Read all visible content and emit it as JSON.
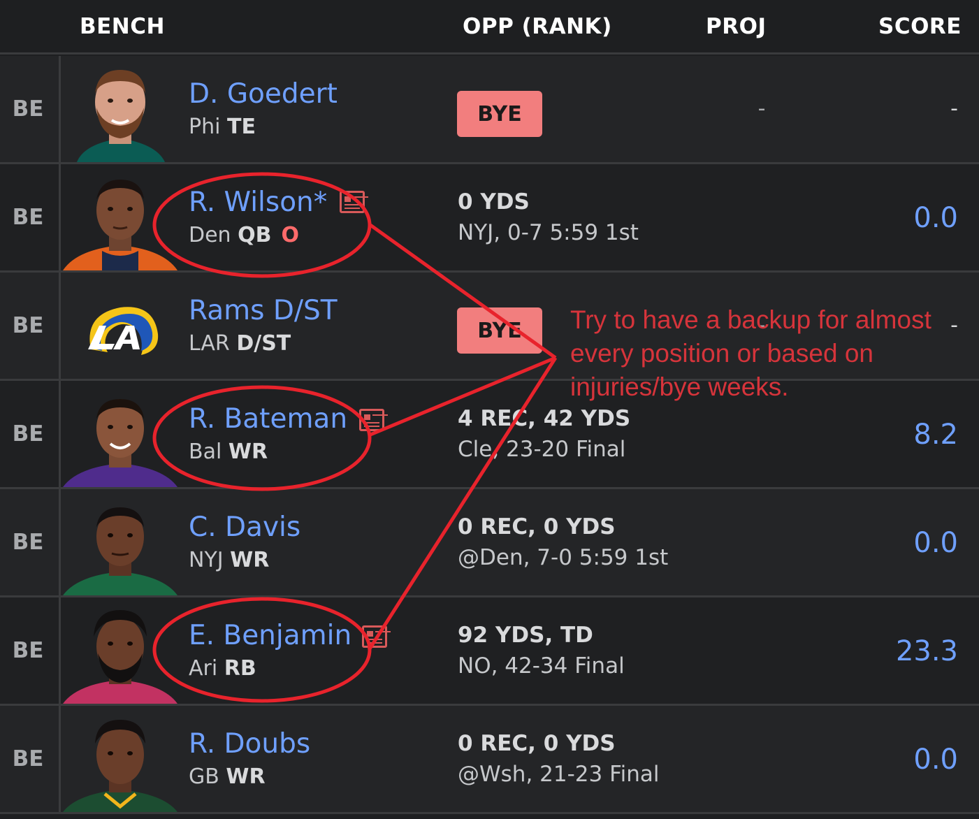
{
  "header": {
    "bench": "BENCH",
    "opp": "OPP (RANK)",
    "proj": "PROJ",
    "score": "SCORE"
  },
  "rows": [
    {
      "slot": "BE",
      "name": "D. Goedert",
      "team": "Phi",
      "pos": "TE",
      "bye": "BYE",
      "proj": "-",
      "score": "-",
      "jersey": "#0b5c54"
    },
    {
      "slot": "BE",
      "name": "R. Wilson*",
      "team": "Den",
      "pos": "QB",
      "status": "O",
      "opp_line1": "0 YDS",
      "opp_line2": "NYJ, 0-7 5:59 1st",
      "score": "0.0",
      "jersey": "#e2601d"
    },
    {
      "slot": "BE",
      "name": "Rams D/ST",
      "team": "LAR",
      "pos": "D/ST",
      "bye": "BYE",
      "proj": "-",
      "score": "-",
      "logo": "rams-logo"
    },
    {
      "slot": "BE",
      "name": "R. Bateman",
      "team": "Bal",
      "pos": "WR",
      "opp_line1": "4 REC, 42 YDS",
      "opp_line2": "Cle, 23-20 Final",
      "score": "8.2",
      "jersey": "#4f2c8c"
    },
    {
      "slot": "BE",
      "name": "C. Davis",
      "team": "NYJ",
      "pos": "WR",
      "opp_line1": "0 REC, 0 YDS",
      "opp_line2": "@Den, 7-0 5:59 1st",
      "score": "0.0",
      "jersey": "#1a6b44"
    },
    {
      "slot": "BE",
      "name": "E. Benjamin",
      "team": "Ari",
      "pos": "RB",
      "opp_line1": "92 YDS, TD",
      "opp_line2": "NO, 42-34 Final",
      "score": "23.3",
      "jersey": "#c23262"
    },
    {
      "slot": "BE",
      "name": "R. Doubs",
      "team": "GB",
      "pos": "WR",
      "opp_line1": "0 REC, 0 YDS",
      "opp_line2": "@Wsh, 21-23 Final",
      "score": "0.0",
      "jersey": "#1c4d31"
    }
  ],
  "annotation": {
    "text": "Try to have a backup for almost every position or based on injuries/bye weeks.",
    "color": "#d6343b"
  },
  "icons": [
    "news-icon",
    "rams-logo",
    "player-headshot"
  ]
}
